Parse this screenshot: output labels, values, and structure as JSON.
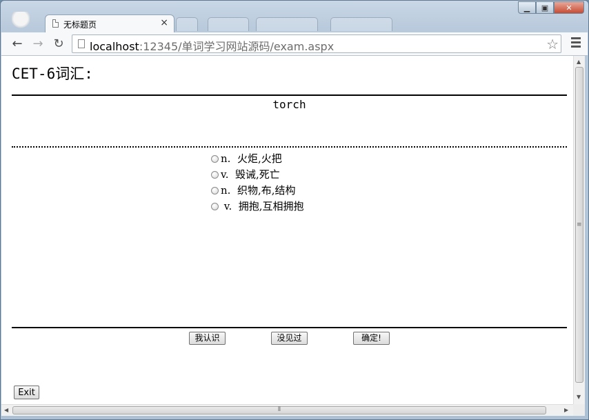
{
  "browser": {
    "tab_title": "无标题页",
    "tab_close": "×",
    "url_host": "localhost",
    "url_path": ":12345/单词学习网站源码/exam.aspx",
    "star": "☆"
  },
  "page": {
    "heading": "CET-6词汇:",
    "word": "torch",
    "options": [
      {
        "label": "n.  火炬,火把"
      },
      {
        "label": "v.  毁诫,死亡"
      },
      {
        "label": "n.  织物,布,结构"
      },
      {
        "label": " v.  拥抱,互相拥抱"
      }
    ],
    "buttons": {
      "know": "我认识",
      "unknown": "没见过",
      "confirm": "确定!",
      "exit": "Exit"
    }
  }
}
